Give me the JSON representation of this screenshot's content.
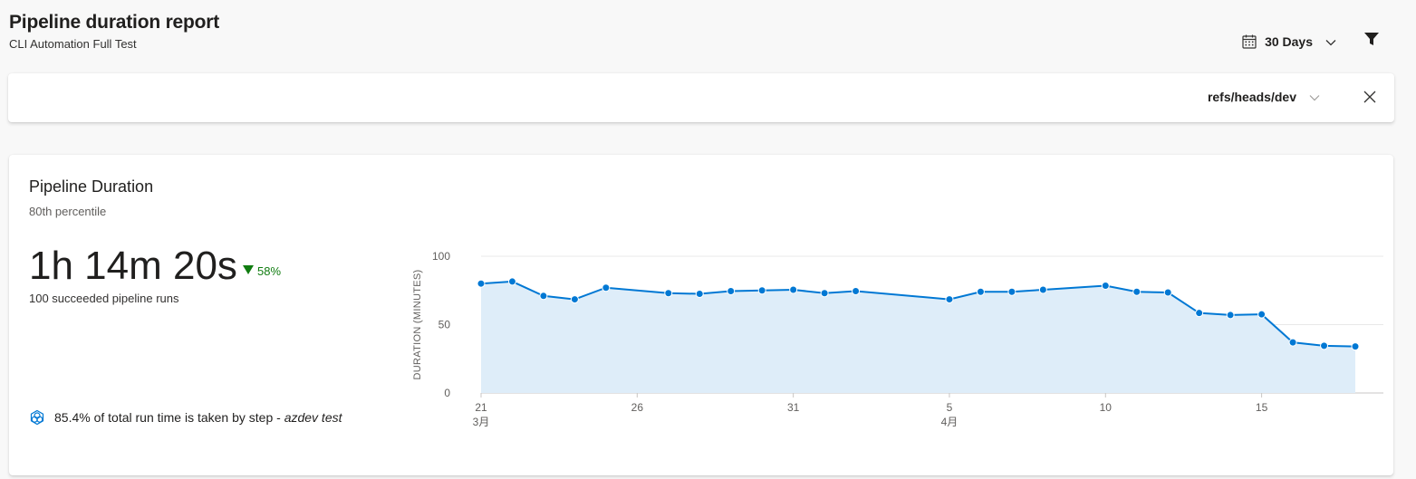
{
  "header": {
    "title": "Pipeline duration report",
    "subtitle": "CLI Automation Full Test"
  },
  "toolbar": {
    "range_label": "30 Days",
    "icons": [
      "calendar-icon",
      "chevron-down-icon",
      "filter-icon"
    ]
  },
  "filter_bar": {
    "branch": "refs/heads/dev",
    "icons": [
      "chevron-down-icon",
      "close-icon"
    ]
  },
  "card": {
    "title": "Pipeline Duration",
    "subtitle": "80th percentile",
    "metric": "1h 14m 20s",
    "delta": "58%",
    "delta_direction": "down",
    "delta_color": "#107c10",
    "runs": "100 succeeded pipeline runs",
    "insight_text": "85.4% of total run time is taken by step - ",
    "insight_step": "azdev test"
  },
  "chart_data": {
    "type": "area",
    "ylabel": "DURATION (MINUTES)",
    "ylim": [
      0,
      100
    ],
    "yticks": [
      0,
      50,
      100
    ],
    "xlim": [
      "2024-03-21",
      "2024-04-18"
    ],
    "xticks": [
      {
        "x": "2024-03-21",
        "label": "21",
        "sublabel": "3月"
      },
      {
        "x": "2024-03-26",
        "label": "26",
        "sublabel": ""
      },
      {
        "x": "2024-03-31",
        "label": "31",
        "sublabel": ""
      },
      {
        "x": "2024-04-05",
        "label": "5",
        "sublabel": "4月"
      },
      {
        "x": "2024-04-10",
        "label": "10",
        "sublabel": ""
      },
      {
        "x": "2024-04-15",
        "label": "15",
        "sublabel": ""
      }
    ],
    "grid": true,
    "color": "#0078d4",
    "fill": "#deedf9",
    "points": [
      {
        "x": "2024-03-21",
        "y": 80
      },
      {
        "x": "2024-03-22",
        "y": 81.5
      },
      {
        "x": "2024-03-23",
        "y": 71
      },
      {
        "x": "2024-03-24",
        "y": 68.5
      },
      {
        "x": "2024-03-25",
        "y": 77
      },
      {
        "x": "2024-03-27",
        "y": 73
      },
      {
        "x": "2024-03-28",
        "y": 72.5
      },
      {
        "x": "2024-03-29",
        "y": 74.5
      },
      {
        "x": "2024-03-30",
        "y": 75
      },
      {
        "x": "2024-03-31",
        "y": 75.5
      },
      {
        "x": "2024-04-01",
        "y": 73
      },
      {
        "x": "2024-04-02",
        "y": 74.5
      },
      {
        "x": "2024-04-05",
        "y": 68.5
      },
      {
        "x": "2024-04-06",
        "y": 74
      },
      {
        "x": "2024-04-07",
        "y": 74
      },
      {
        "x": "2024-04-08",
        "y": 75.5
      },
      {
        "x": "2024-04-10",
        "y": 78.5
      },
      {
        "x": "2024-04-11",
        "y": 74
      },
      {
        "x": "2024-04-12",
        "y": 73.5
      },
      {
        "x": "2024-04-13",
        "y": 58.5
      },
      {
        "x": "2024-04-14",
        "y": 57
      },
      {
        "x": "2024-04-15",
        "y": 57.5
      },
      {
        "x": "2024-04-16",
        "y": 37
      },
      {
        "x": "2024-04-17",
        "y": 34.5
      },
      {
        "x": "2024-04-18",
        "y": 34
      }
    ]
  }
}
